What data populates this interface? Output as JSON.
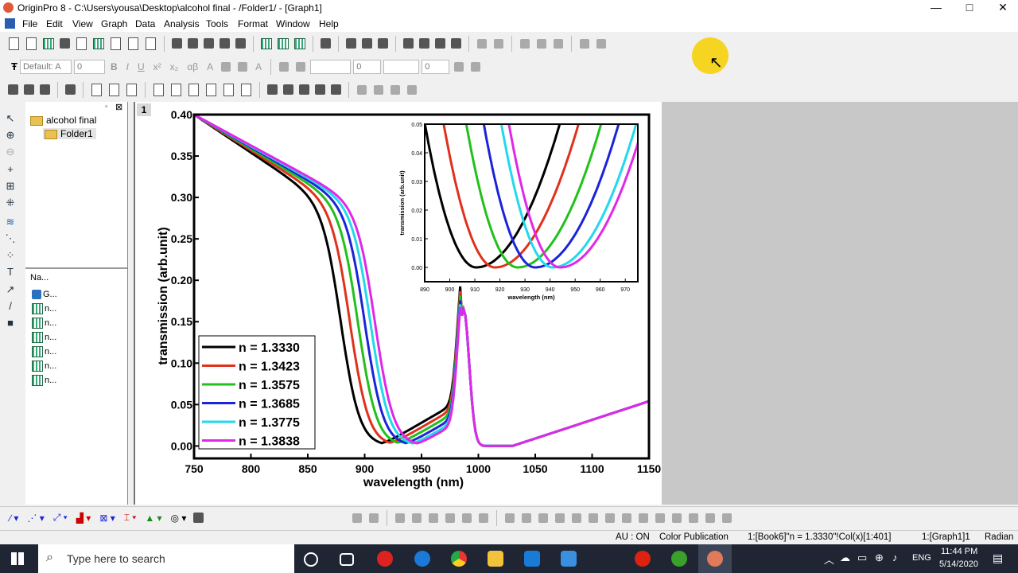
{
  "window": {
    "title": "OriginPro 8 - C:\\Users\\yousa\\Desktop\\alcohol final - /Folder1/ - [Graph1]",
    "minimize": "—",
    "maximize": "□",
    "close": "✕"
  },
  "menu": [
    "File",
    "Edit",
    "View",
    "Graph",
    "Data",
    "Analysis",
    "Tools",
    "Format",
    "Window",
    "Help"
  ],
  "format_toolbar": {
    "font": "Default: A",
    "size": "0",
    "line_size": "0",
    "fill_size": "0"
  },
  "explorer": {
    "root": "alcohol final",
    "child": "Folder1",
    "list_header": "Na...",
    "items": [
      "G...",
      "n...",
      "n...",
      "n...",
      "n...",
      "n...",
      "n..."
    ]
  },
  "graph_window": {
    "layer_badge": "1"
  },
  "chart_data": [
    {
      "type": "line",
      "xlabel": "wavelength (nm)",
      "ylabel": "transmission (arb.unit)",
      "xlim": [
        750,
        1150
      ],
      "ylim": [
        -0.015,
        0.4
      ],
      "xticks": [
        "750",
        "800",
        "850",
        "900",
        "950",
        "1000",
        "1050",
        "1100",
        "1150"
      ],
      "yticks": [
        "0.00",
        "0.05",
        "0.10",
        "0.15",
        "0.20",
        "0.25",
        "0.30",
        "0.35",
        "0.40"
      ],
      "grid": false,
      "legend_position": "bottom-left",
      "series": [
        {
          "name": "n = 1.3330",
          "color": "#000000",
          "dip": 915,
          "fall": 880
        },
        {
          "name": "n = 1.3423",
          "color": "#e0311c",
          "dip": 922,
          "fall": 888
        },
        {
          "name": "n = 1.3575",
          "color": "#22c01a",
          "dip": 929,
          "fall": 895
        },
        {
          "name": "n = 1.3685",
          "color": "#1a24d8",
          "dip": 936,
          "fall": 901
        },
        {
          "name": "n = 1.3775",
          "color": "#22d8ee",
          "dip": 942,
          "fall": 906
        },
        {
          "name": "n = 1.3838",
          "color": "#e028e8",
          "dip": 946,
          "fall": 910
        }
      ]
    },
    {
      "type": "line",
      "xlabel": "wavelength (nm)",
      "ylabel": "transmission (arb.unit)",
      "xlim": [
        890,
        975
      ],
      "ylim": [
        -0.005,
        0.05
      ],
      "xticks": [
        "890",
        "900",
        "910",
        "920",
        "930",
        "940",
        "950",
        "960",
        "970"
      ],
      "yticks": [
        "0.00",
        "0.01",
        "0.02",
        "0.03",
        "0.04",
        "0.05"
      ],
      "grid": false,
      "minima": [
        {
          "x": 910.5,
          "color": "#000000"
        },
        {
          "x": 918,
          "color": "#e0311c"
        },
        {
          "x": 927,
          "color": "#22c01a"
        },
        {
          "x": 934,
          "color": "#1a24d8"
        },
        {
          "x": 941,
          "color": "#22d8ee"
        },
        {
          "x": 944,
          "color": "#e028e8"
        }
      ]
    }
  ],
  "status": {
    "au": "AU : ON",
    "mode": "Color Publication",
    "cell": "1:[Book6]\"n = 1.3330\"!Col(x)[1:401]",
    "graph": "1:[Graph1]1",
    "unit": "Radian"
  },
  "taskbar": {
    "search_placeholder": "Type here to search",
    "lang": "ENG",
    "time": "11:44 PM",
    "date": "5/14/2020"
  }
}
